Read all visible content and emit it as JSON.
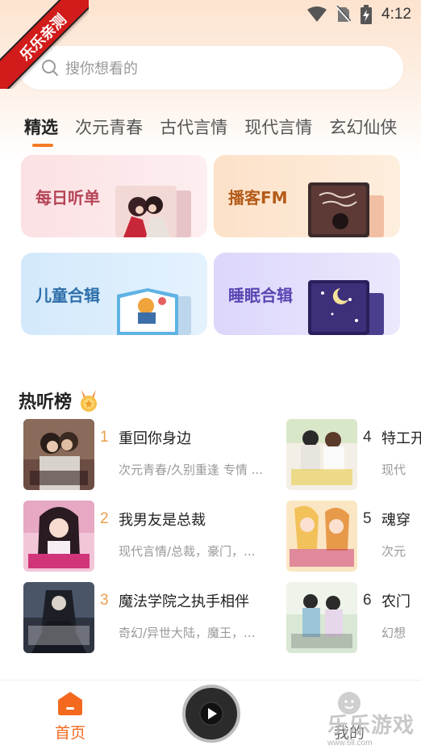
{
  "status_bar": {
    "time": "4:12",
    "icons": [
      "wifi-icon",
      "no-sim-icon",
      "battery-charging-icon"
    ]
  },
  "corner_ribbon": {
    "text": "乐乐亲测"
  },
  "search": {
    "placeholder": "搜你想看的"
  },
  "tabs": [
    {
      "label": "精选",
      "active": true
    },
    {
      "label": "次元青春",
      "active": false
    },
    {
      "label": "古代言情",
      "active": false
    },
    {
      "label": "现代言情",
      "active": false
    },
    {
      "label": "玄幻仙侠",
      "active": false
    }
  ],
  "categories": [
    {
      "label": "每日听单"
    },
    {
      "label": "播客FM"
    },
    {
      "label": "儿童合辑"
    },
    {
      "label": "睡眠合辑"
    }
  ],
  "hot_list": {
    "title": "热听榜",
    "items": [
      {
        "rank": "1",
        "title": "重回你身边",
        "desc": "次元青春/久别重逢 专情 ..."
      },
      {
        "rank": "2",
        "title": "我男友是总裁",
        "desc": "现代言情/总裁，豪门，..."
      },
      {
        "rank": "3",
        "title": "魔法学院之执手相伴",
        "desc": "奇幻/异世大陆，魔王，..."
      },
      {
        "rank": "4",
        "title": "特工开挂",
        "desc": "现代"
      },
      {
        "rank": "5",
        "title": "魂穿",
        "desc": "次元"
      },
      {
        "rank": "6",
        "title": "农门",
        "desc": "幻想"
      }
    ]
  },
  "bottom_nav": {
    "home_label": "首页",
    "mine_label": "我的"
  },
  "watermark": {
    "brand": "乐乐游戏",
    "url": "www.6ll.com"
  },
  "colors": {
    "accent": "#f36a1f",
    "rank_top": "#e8a04a",
    "ribbon": "#d21b1b"
  }
}
